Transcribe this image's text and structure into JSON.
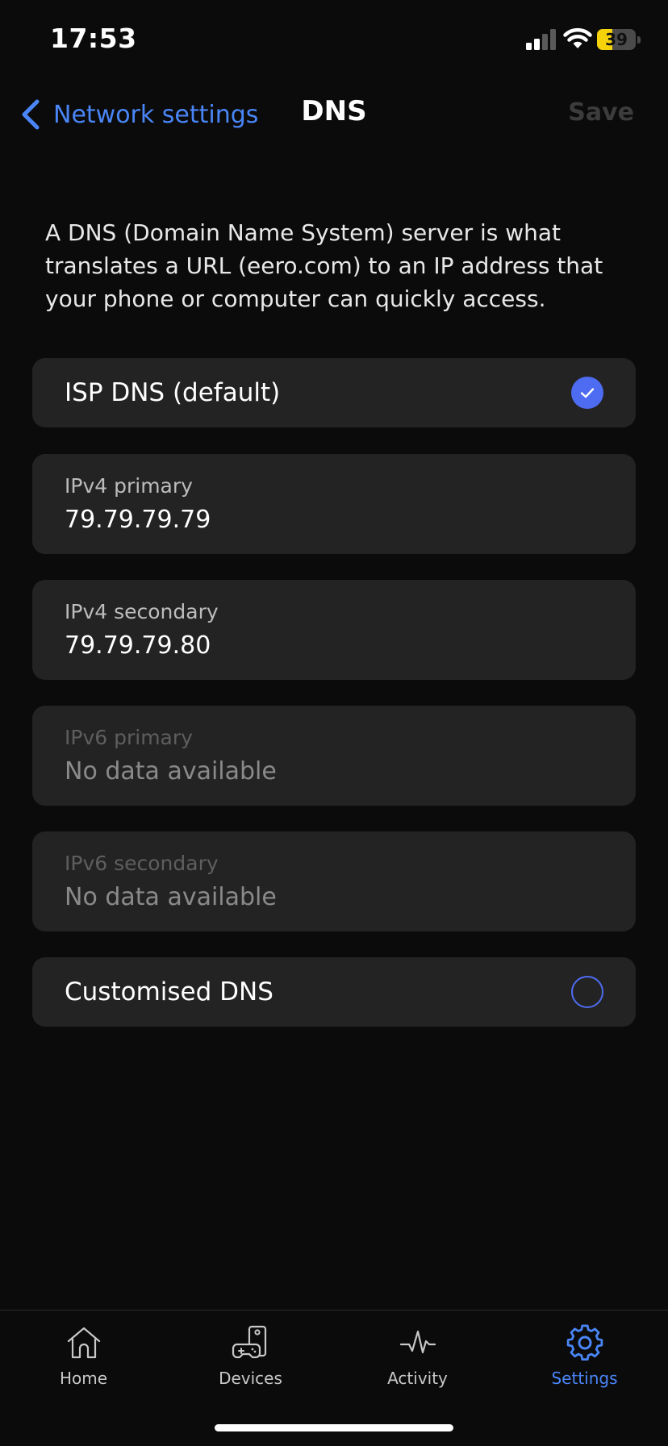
{
  "status_bar": {
    "time": "17:53",
    "battery": "39",
    "battery_fraction": 0.39
  },
  "nav": {
    "back_label": "Network settings",
    "title": "DNS",
    "save_label": "Save"
  },
  "description": "A DNS (Domain Name System) server is what translates a URL (eero.com) to an IP address that your phone or computer can quickly access.",
  "options": {
    "isp": {
      "label": "ISP DNS (default)",
      "selected": true
    },
    "custom": {
      "label": "Customised DNS",
      "selected": false
    }
  },
  "fields": [
    {
      "label": "IPv4 primary",
      "value": "79.79.79.79",
      "enabled": true
    },
    {
      "label": "IPv4 secondary",
      "value": "79.79.79.80",
      "enabled": true
    },
    {
      "label": "IPv6 primary",
      "value": "No data available",
      "enabled": false
    },
    {
      "label": "IPv6 secondary",
      "value": "No data available",
      "enabled": false
    }
  ],
  "tabs": [
    {
      "label": "Home",
      "icon": "home-icon",
      "active": false
    },
    {
      "label": "Devices",
      "icon": "devices-icon",
      "active": false
    },
    {
      "label": "Activity",
      "icon": "activity-icon",
      "active": false
    },
    {
      "label": "Settings",
      "icon": "gear-icon",
      "active": true
    }
  ],
  "colors": {
    "accent": "#4a86f7",
    "radio": "#4e6cf2",
    "card": "#232323",
    "background": "#0b0b0b",
    "battery": "#f5d20a"
  }
}
